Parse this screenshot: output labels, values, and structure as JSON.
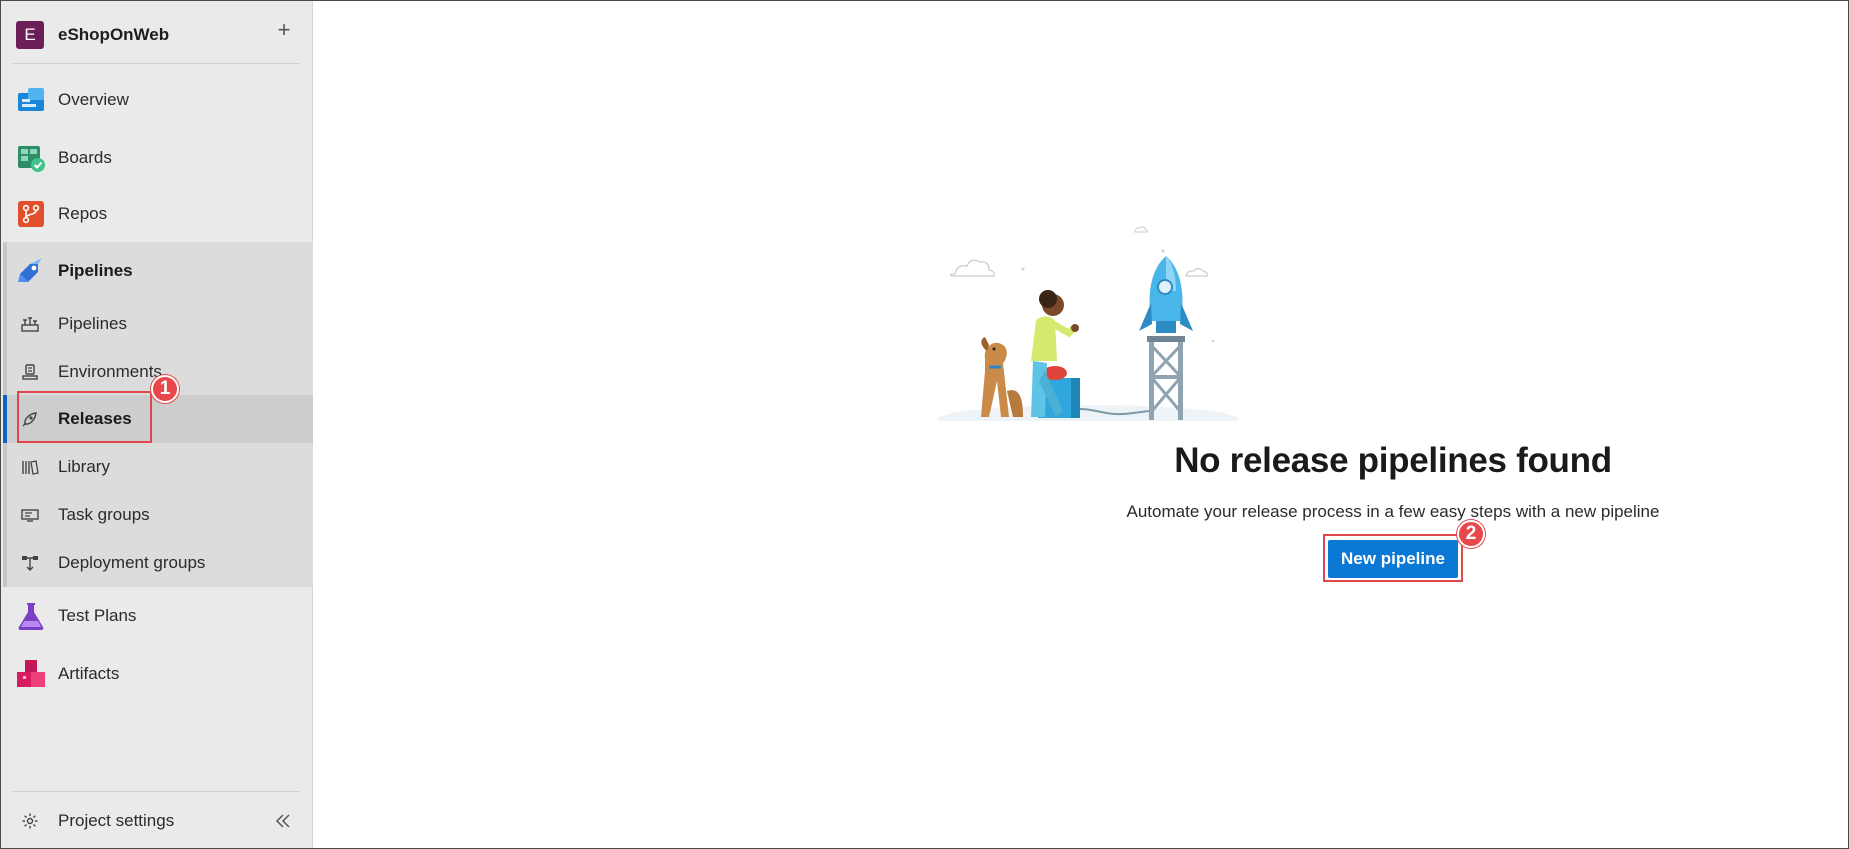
{
  "org": {
    "initial": "E",
    "name": "eShopOnWeb",
    "add_icon": "plus-icon"
  },
  "nav": {
    "overview": {
      "label": "Overview",
      "icon": "overview-icon"
    },
    "boards": {
      "label": "Boards",
      "icon": "boards-icon"
    },
    "repos": {
      "label": "Repos",
      "icon": "repos-icon"
    },
    "pipelines": {
      "label": "Pipelines",
      "icon": "pipelines-icon"
    },
    "sub": {
      "pipelines": {
        "label": "Pipelines",
        "icon": "pipelines-sub-icon"
      },
      "environments": {
        "label": "Environments",
        "icon": "environments-icon"
      },
      "releases": {
        "label": "Releases",
        "icon": "releases-icon"
      },
      "library": {
        "label": "Library",
        "icon": "library-icon"
      },
      "task_groups": {
        "label": "Task groups",
        "icon": "task-groups-icon"
      },
      "deployment_groups": {
        "label": "Deployment groups",
        "icon": "deployment-groups-icon"
      }
    },
    "test_plans": {
      "label": "Test Plans",
      "icon": "test-plans-icon"
    },
    "artifacts": {
      "label": "Artifacts",
      "icon": "artifacts-icon"
    },
    "project_settings": {
      "label": "Project settings",
      "icon": "gear-icon"
    },
    "collapse_icon": "double-chevron-left-icon"
  },
  "main": {
    "title": "No release pipelines found",
    "subtitle": "Automate your release process in a few easy steps with a new pipeline",
    "new_pipeline_label": "New pipeline",
    "illustration": "rocket-launch-illustration"
  },
  "annotations": {
    "step1": "1",
    "step2": "2"
  },
  "colors": {
    "accent": "#0a78d4",
    "selected_bar": "#0a66c2",
    "annotation": "#e0484b",
    "org_avatar": "#6b1e57"
  }
}
